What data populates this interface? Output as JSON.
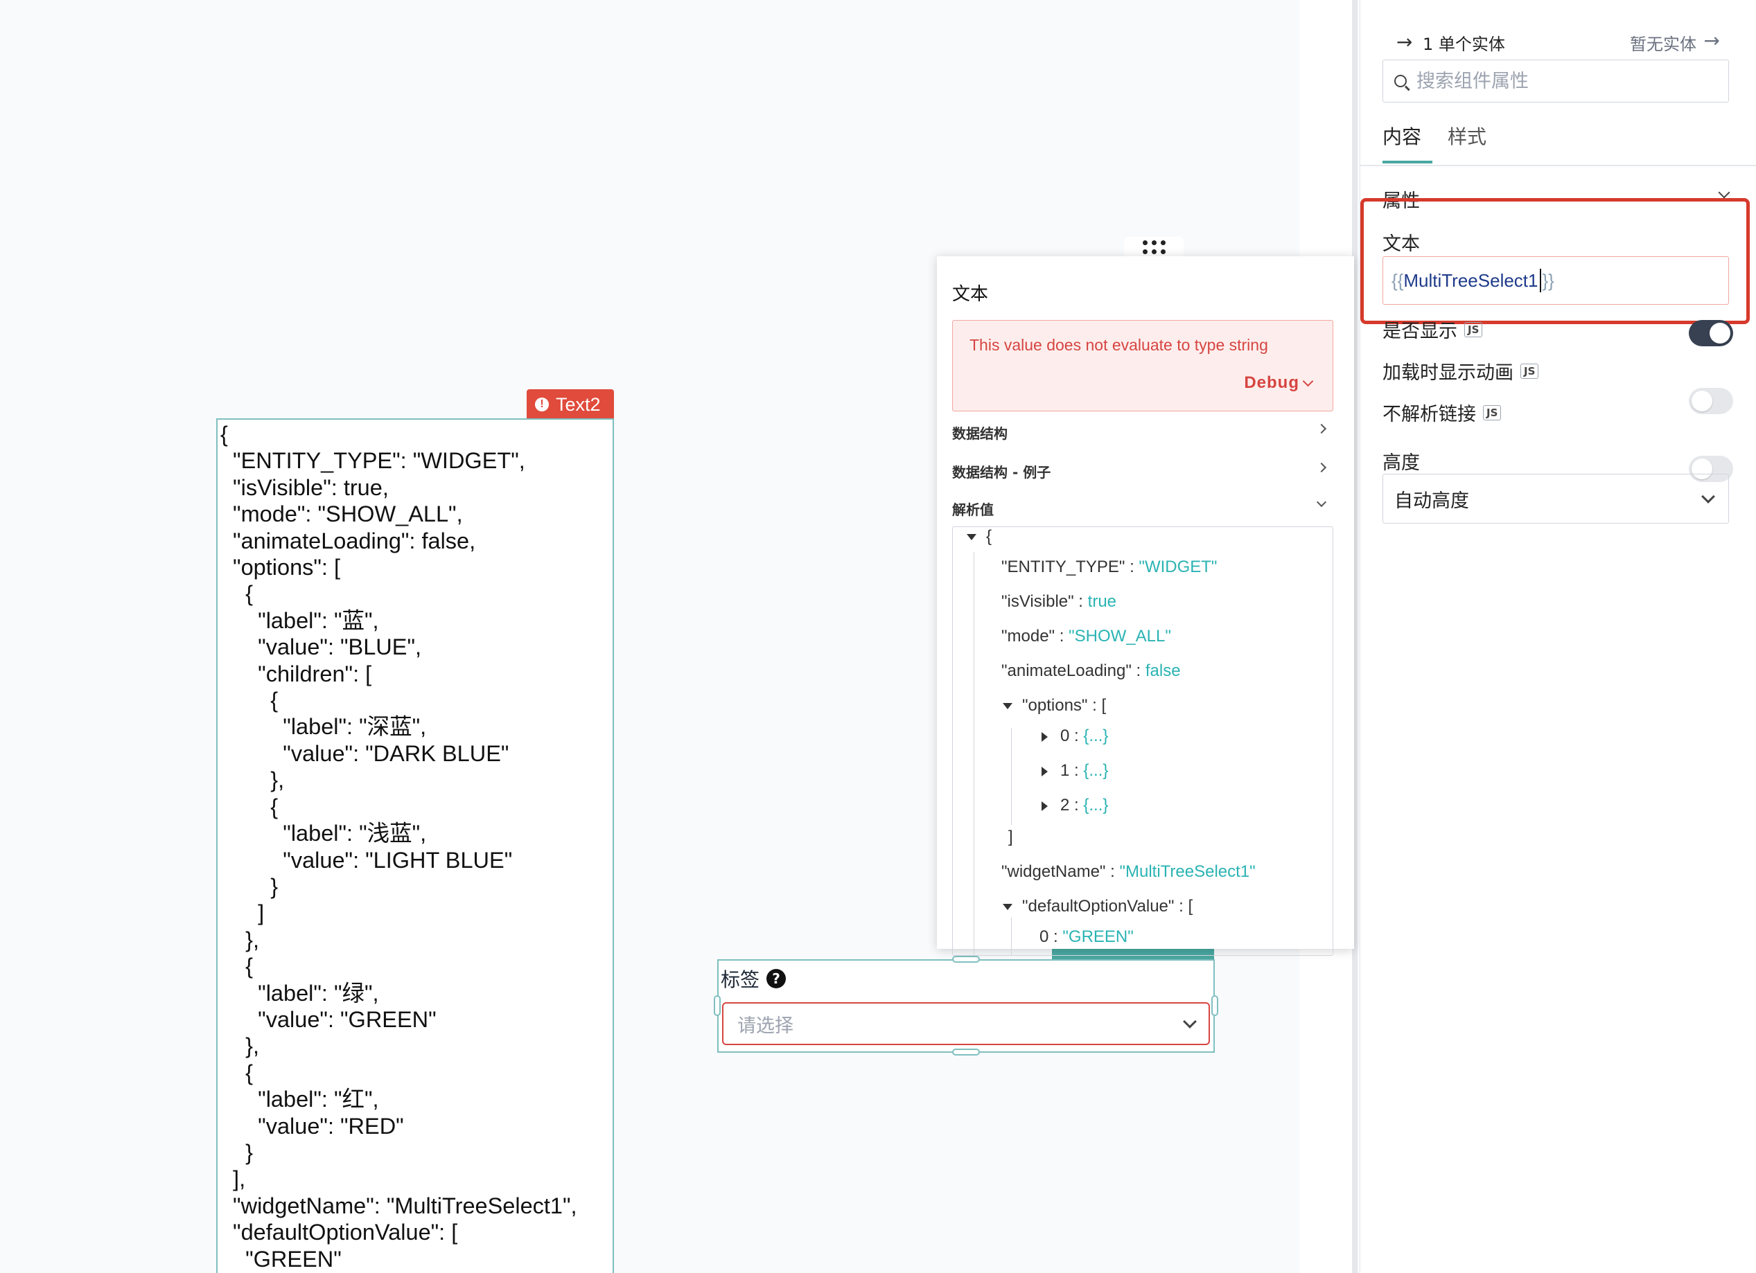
{
  "canvas": {
    "text2": {
      "badge_label": "Text2",
      "lines": [
        "{",
        "  \"ENTITY_TYPE\": \"WIDGET\",",
        "  \"isVisible\": true,",
        "  \"mode\": \"SHOW_ALL\",",
        "  \"animateLoading\": false,",
        "  \"options\": [",
        "    {",
        "      \"label\": \"蓝\",",
        "      \"value\": \"BLUE\",",
        "      \"children\": [",
        "        {",
        "          \"label\": \"深蓝\",",
        "          \"value\": \"DARK BLUE\"",
        "        },",
        "        {",
        "          \"label\": \"浅蓝\",",
        "          \"value\": \"LIGHT BLUE\"",
        "        }",
        "      ]",
        "    },",
        "    {",
        "      \"label\": \"绿\",",
        "      \"value\": \"GREEN\"",
        "    },",
        "    {",
        "      \"label\": \"红\",",
        "      \"value\": \"RED\"",
        "    }",
        "  ],",
        "  \"widgetName\": \"MultiTreeSelect1\",",
        "  \"defaultOptionValue\": [",
        "    \"GREEN\""
      ]
    },
    "select_widget": {
      "label": "标签",
      "help_icon": "question-circle-icon",
      "placeholder": "请选择"
    }
  },
  "popover": {
    "title": "文本",
    "error_message": "This value does not evaluate to type string",
    "debug_label": "Debug",
    "sections": {
      "data_structure": "数据结构",
      "data_structure_example": "数据结构 - 例子",
      "evaluated_value": "解析值"
    },
    "tree": {
      "open_brace": "{",
      "rows": {
        "entity_type": {
          "key": "\"ENTITY_TYPE\"",
          "value": "\"WIDGET\""
        },
        "is_visible": {
          "key": "\"isVisible\"",
          "value": "true"
        },
        "mode": {
          "key": "\"mode\"",
          "value": "\"SHOW_ALL\""
        },
        "animate_loading": {
          "key": "\"animateLoading\"",
          "value": "false"
        },
        "options": {
          "key": "\"options\"",
          "open": "["
        },
        "option_0": {
          "key": "0",
          "value": "{...}"
        },
        "option_1": {
          "key": "1",
          "value": "{...}"
        },
        "option_2": {
          "key": "2",
          "value": "{...}"
        },
        "options_close": "]",
        "widget_name": {
          "key": "\"widgetName\"",
          "value": "\"MultiTreeSelect1\""
        },
        "default_option_value": {
          "key": "\"defaultOptionValue\"",
          "open": "["
        },
        "default_0": {
          "key": "0",
          "value": "\"GREEN\""
        }
      }
    }
  },
  "panel": {
    "entity_label": "1 单个实体",
    "no_entity_label": "暂无实体",
    "search_placeholder": "搜索组件属性",
    "tabs": {
      "content": "内容",
      "style": "样式"
    },
    "section_title": "属性",
    "text_field": {
      "label": "文本",
      "open": "{{",
      "expr": "MultiTreeSelect1",
      "close": "}}"
    },
    "visible": {
      "label": "是否显示",
      "js": "JS",
      "on": true
    },
    "animate_loading": {
      "label": "加载时显示动画",
      "js": "JS",
      "on": false
    },
    "no_parse_link": {
      "label": "不解析链接",
      "js": "JS",
      "on": false
    },
    "height": {
      "label": "高度",
      "value": "自动高度"
    }
  },
  "colors": {
    "accent": "#49a8a0",
    "error": "#d64541",
    "highlight": "#d63a2c",
    "string_value": "#2bb3b3"
  }
}
